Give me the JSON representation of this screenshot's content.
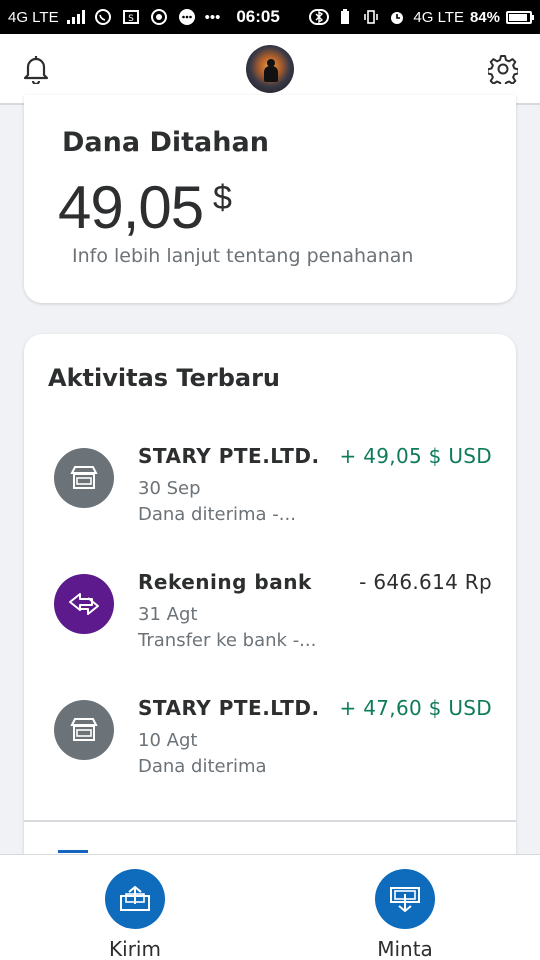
{
  "status_bar": {
    "network_left": "4G LTE",
    "time": "06:05",
    "network_right": "4G LTE",
    "battery": "84%",
    "icons": [
      "signal-icon",
      "whatsapp-icon",
      "notification-icon",
      "chrome-icon",
      "messenger-icon",
      "more-icon",
      "bluetooth-icon",
      "battery-saver-icon",
      "vibrate-icon",
      "alarm-icon",
      "battery-icon"
    ]
  },
  "header": {
    "icons": [
      "bell-icon",
      "avatar",
      "gear-icon"
    ]
  },
  "held_funds": {
    "title": "Dana Ditahan",
    "amount": "49,05",
    "currency": "$",
    "info_link": "Info lebih lanjut tentang penahanan"
  },
  "activity": {
    "title": "Aktivitas Terbaru",
    "items": [
      {
        "name": "STARY PTE.LTD.",
        "date": "30 Sep",
        "desc": "Dana diterima -...",
        "amount": "+ 49,05 $ USD",
        "icon": "store-icon",
        "icon_color": "#6c7378",
        "amount_color": "#0e7b5b"
      },
      {
        "name": "Rekening bank",
        "date": "31 Agt",
        "desc": "Transfer ke bank -...",
        "amount": "- 646.614 Rp",
        "icon": "transfer-icon",
        "icon_color": "#5c1a8c",
        "amount_color": "#2c2e2f"
      },
      {
        "name": "STARY PTE.LTD.",
        "date": "10 Agt",
        "desc": "Dana diterima",
        "amount": "+ 47,60 $ USD",
        "icon": "store-icon",
        "icon_color": "#6c7378",
        "amount_color": "#0e7b5b"
      }
    ]
  },
  "bottom_nav": {
    "send_label": "Kirim",
    "request_label": "Minta",
    "accent": "#0f6cbd"
  }
}
